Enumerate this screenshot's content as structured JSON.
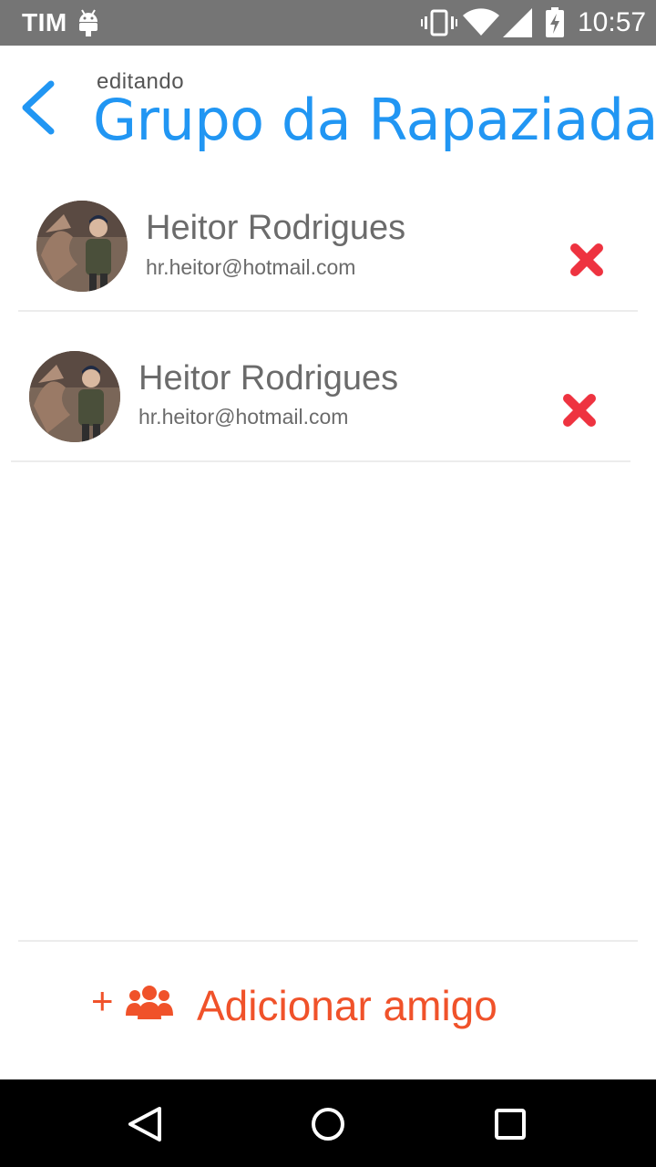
{
  "status_bar": {
    "carrier": "TIM",
    "time": "10:57",
    "icons": [
      "android-icon",
      "vibrate-icon",
      "wifi-icon",
      "signal-icon",
      "battery-charging-icon"
    ]
  },
  "header": {
    "subtitle": "editando",
    "title": "Grupo da Rapaziada",
    "accent_color": "#2196f3"
  },
  "members": [
    {
      "name": "Heitor Rodrigues",
      "email": "hr.heitor@hotmail.com"
    },
    {
      "name": "Heitor Rodrigues",
      "email": "hr.heitor@hotmail.com"
    }
  ],
  "remove_color": "#ee3340",
  "footer": {
    "plus": "+",
    "add_friend_label": "Adicionar amigo",
    "color": "#f0522a"
  },
  "nav_bar": {
    "icons": [
      "back-triangle-icon",
      "home-circle-icon",
      "recents-square-icon"
    ]
  }
}
